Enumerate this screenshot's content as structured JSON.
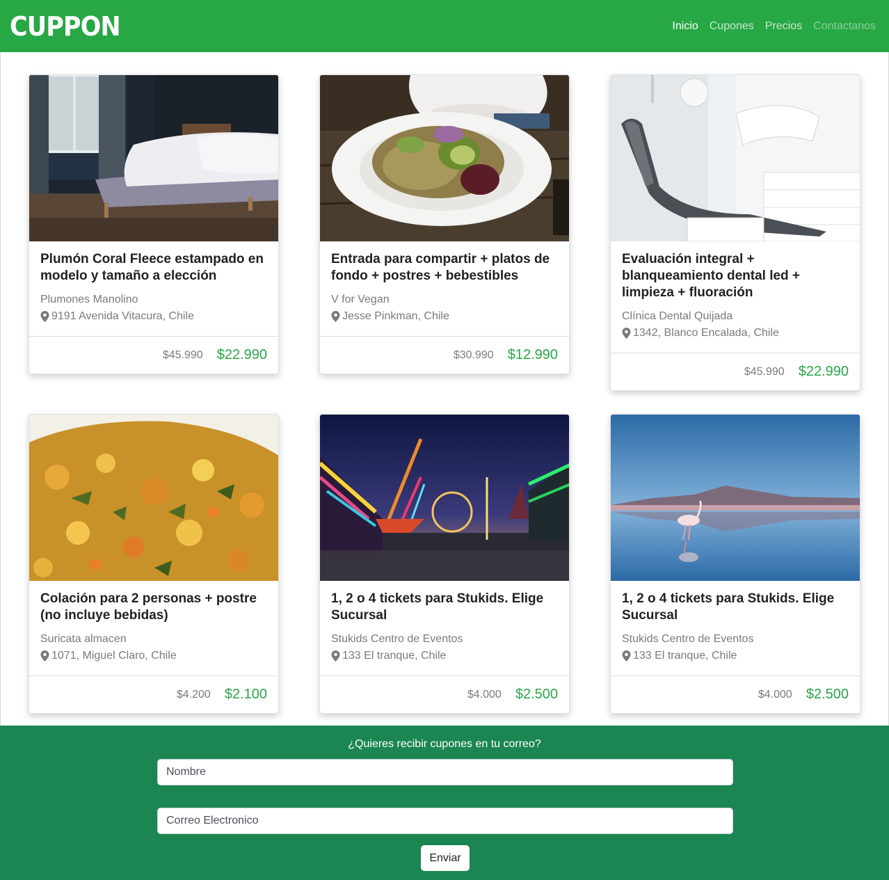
{
  "brand": "CUPPON",
  "nav": {
    "items": [
      "Inicio",
      "Cupones",
      "Precios",
      "Contactanos"
    ]
  },
  "cards": [
    {
      "title": "Plumón Coral Fleece estampado en modelo y tamaño a elección",
      "vendor": "Plumones Manolino",
      "location": "9191 Avenida Vitacura, Chile",
      "old_price": "$45.990",
      "new_price": "$22.990",
      "image": "bedroom-photo"
    },
    {
      "title": "Entrada para compartir + platos de fondo + postres + bebestibles",
      "vendor": "V for Vegan",
      "location": "Jesse Pinkman, Chile",
      "old_price": "$30.990",
      "new_price": "$12.990",
      "image": "salad-plate-photo"
    },
    {
      "title": "Evaluación integral + blanqueamiento dental led + limpieza + fluoración",
      "vendor": "Clínica Dental Quijada",
      "location": "1342, Blanco Encalada, Chile",
      "old_price": "$45.990",
      "new_price": "$22.990",
      "image": "dental-chair-photo"
    },
    {
      "title": "Colación para 2 personas + postre (no incluye bebidas)",
      "vendor": "Suricata almacen",
      "location": "1071, Miguel Claro, Chile",
      "old_price": "$4.200",
      "new_price": "$2.100",
      "image": "rice-dish-photo"
    },
    {
      "title": "1, 2 o 4 tickets para Stukids. Elige Sucursal",
      "vendor": "Stukids Centro de Eventos",
      "location": "133 El tranque, Chile",
      "old_price": "$4.000",
      "new_price": "$2.500",
      "image": "fair-night-photo"
    },
    {
      "title": "1, 2 o 4 tickets para Stukids. Elige Sucursal",
      "vendor": "Stukids Centro de Eventos",
      "location": "133 El tranque, Chile",
      "old_price": "$4.000",
      "new_price": "$2.500",
      "image": "flamingo-lake-photo"
    }
  ],
  "newsletter": {
    "title": "¿Quieres recibir cupones en tu correo?",
    "name_placeholder": "Nombre",
    "email_placeholder": "Correo Electronico",
    "submit_label": "Enviar"
  },
  "colors": {
    "primary": "#28a745",
    "footer": "#1b8651"
  }
}
